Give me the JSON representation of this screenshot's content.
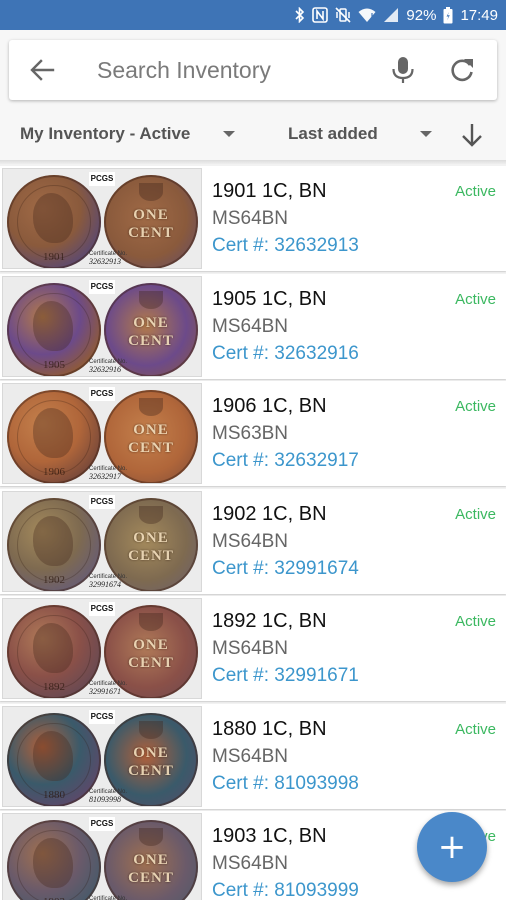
{
  "status_bar": {
    "battery": "92%",
    "time": "17:49",
    "icons": [
      "bluetooth-icon",
      "nfc-icon",
      "vibrate-icon",
      "wifi-icon",
      "signal-icon",
      "battery-icon"
    ]
  },
  "search": {
    "placeholder": "Search Inventory",
    "value": "",
    "icons": [
      "back-arrow-icon",
      "microphone-icon",
      "refresh-icon"
    ]
  },
  "filters": {
    "inventory": "My Inventory - Active",
    "sort": "Last added",
    "sort_direction_icon": "arrow-down-icon"
  },
  "items": [
    {
      "title": "1901 1C, BN",
      "grade": "MS64BN",
      "cert": "Cert #: 32632913",
      "status": "Active",
      "thumb_cert": "32632913",
      "year": "1901"
    },
    {
      "title": "1905 1C, BN",
      "grade": "MS64BN",
      "cert": "Cert #: 32632916",
      "status": "Active",
      "thumb_cert": "32632916",
      "year": "1905"
    },
    {
      "title": "1906 1C, BN",
      "grade": "MS63BN",
      "cert": "Cert #: 32632917",
      "status": "Active",
      "thumb_cert": "32632917",
      "year": "1906"
    },
    {
      "title": "1902 1C, BN",
      "grade": "MS64BN",
      "cert": "Cert #: 32991674",
      "status": "Active",
      "thumb_cert": "32991674",
      "year": "1902"
    },
    {
      "title": "1892 1C, BN",
      "grade": "MS64BN",
      "cert": "Cert #: 32991671",
      "status": "Active",
      "thumb_cert": "32991671",
      "year": "1892"
    },
    {
      "title": "1880 1C, BN",
      "grade": "MS64BN",
      "cert": "Cert #: 81093998",
      "status": "Active",
      "thumb_cert": "81093998",
      "year": "1880"
    },
    {
      "title": "1903 1C, BN",
      "grade": "MS64BN",
      "cert": "Cert #: 81093999",
      "status": "Active",
      "thumb_cert": "81093999",
      "year": "1903"
    }
  ],
  "thumbnail": {
    "grader_logo": "PCGS",
    "cert_label": "Certificate No.",
    "reverse_line1": "ONE",
    "reverse_line2": "CENT"
  },
  "fab": {
    "label": "+",
    "icon": "add-icon"
  },
  "colors": {
    "status_bar": "#3e74b6",
    "active_status": "#3bb860",
    "cert_link": "#3c96cc",
    "fab": "#4a88c9"
  }
}
